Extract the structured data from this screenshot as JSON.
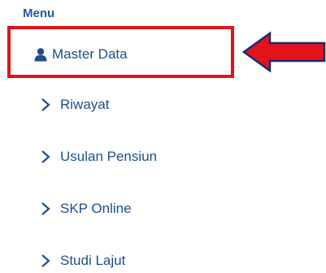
{
  "menu": {
    "heading": "Menu",
    "items": [
      {
        "label": "Master Data",
        "icon": "user-icon",
        "highlighted": true
      },
      {
        "label": "Riwayat",
        "icon": "chevron-right-icon"
      },
      {
        "label": "Usulan Pensiun",
        "icon": "chevron-right-icon"
      },
      {
        "label": "SKP Online",
        "icon": "chevron-right-icon"
      },
      {
        "label": "Studi Lajut",
        "icon": "chevron-right-icon"
      }
    ]
  },
  "annotation": {
    "box_color": "#e3131c",
    "arrow_color": "#e3131c",
    "arrow_outline": "#1a2a6c",
    "arrow_direction": "left"
  },
  "colors": {
    "heading": "#1f5e9c",
    "item_text": "#1f4f86"
  }
}
